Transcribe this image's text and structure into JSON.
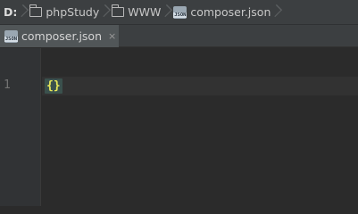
{
  "breadcrumb": {
    "items": [
      {
        "label": "D:",
        "icon": "none"
      },
      {
        "label": "phpStudy",
        "icon": "folder-icon"
      },
      {
        "label": "WWW",
        "icon": "folder-icon"
      },
      {
        "label": "composer.json",
        "icon": "json-file-icon"
      }
    ]
  },
  "tabs": [
    {
      "label": "composer.json",
      "icon": "json-file-icon",
      "close": "×",
      "active": true
    }
  ],
  "icon_text": "JSON",
  "editor": {
    "line_numbers": [
      "1"
    ],
    "lines": [
      "{}"
    ]
  },
  "colors": {
    "brace": "#e8e85a",
    "background": "#2b2b2b",
    "gutter": "#313335"
  }
}
